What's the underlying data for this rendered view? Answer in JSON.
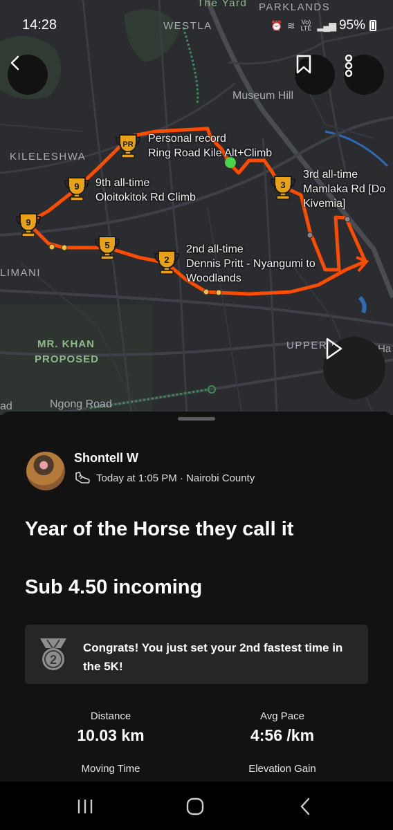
{
  "status_bar": {
    "time": "14:28",
    "network": "Vo) LTE",
    "battery": "95%"
  },
  "map": {
    "area_labels": [
      "The Yard",
      "PARKLANDS",
      "WESTLA",
      "Museum Hill",
      "KILELESHWA",
      "LIMANI",
      "MR. KHAN",
      "PROPOSED",
      "UPPER H",
      "Ha",
      "ad",
      "Ngong Road"
    ],
    "segments": [
      {
        "badge": "PR",
        "line1": "Personal record",
        "line2": "Ring Road Kile Alt+Climb"
      },
      {
        "badge": "3",
        "line1": "3rd all-time",
        "line2": "Mamlaka Rd [Do",
        "line3": "Kivemia]"
      },
      {
        "badge": "9",
        "line1": "9th all-time",
        "line2": "Oloitokitok Rd Climb"
      },
      {
        "badge": "2",
        "line1": "2nd all-time",
        "line2": "Dennis Pritt - Nyangumi to",
        "line3": "Woodlands"
      },
      {
        "badge": "9"
      },
      {
        "badge": "5"
      }
    ],
    "route_color": "#fc4c02",
    "badge_color": "#e8a21a"
  },
  "buttons": {
    "back": "back-arrow-icon",
    "bookmark": "bookmark-icon",
    "more": "more-vertical-icon",
    "play": "play-icon"
  },
  "activity": {
    "athlete": "Shontell W",
    "meta": "Today at 1:05 PM · Nairobi County",
    "title": "Year of the Horse they call it",
    "description": "Sub 4.50 incoming",
    "achievement": "Congrats! You just set your 2nd fastest time in the 5K!",
    "achievement_medal": "2",
    "stats": [
      {
        "label": "Distance",
        "value": "10.03 km"
      },
      {
        "label": "Avg Pace",
        "value": "4:56 /km"
      },
      {
        "label": "Moving Time",
        "value": ""
      },
      {
        "label": "Elevation Gain",
        "value": ""
      }
    ]
  },
  "nav": {
    "recents": "recents-icon",
    "home": "home-icon",
    "back": "back-icon"
  }
}
